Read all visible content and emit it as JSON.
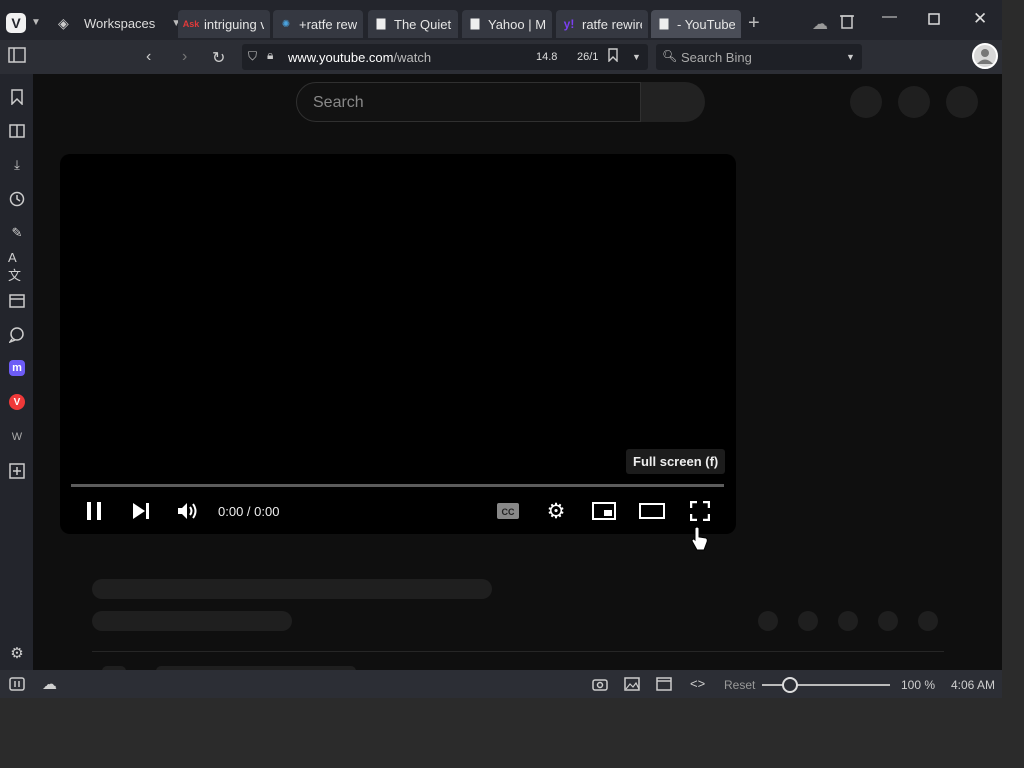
{
  "browser": {
    "workspaces_label": "Workspaces",
    "tabs": [
      {
        "title": "intriguing v",
        "fav": "ask-icon"
      },
      {
        "title": "+ratfe rewi",
        "fav": "wp-icon"
      },
      {
        "title": "The Quietu",
        "fav": "page-icon"
      },
      {
        "title": "Yahoo | Ma",
        "fav": "page-icon"
      },
      {
        "title": "ratfe rewire",
        "fav": "yahoo-icon"
      },
      {
        "title": "- YouTube",
        "fav": "page-icon"
      }
    ],
    "url_host": "www.youtube.com",
    "url_path": "/watch",
    "counter_a": "14.8",
    "counter_b": "26/1",
    "search_placeholder": "Search Bing"
  },
  "youtube": {
    "search_placeholder": "Search",
    "player": {
      "time": "0:00 / 0:00",
      "tooltip": "Full screen (f)"
    }
  },
  "statusbar": {
    "reset_label": "Reset",
    "zoom": "100 %",
    "clock": "4:06 AM",
    "zoom_fraction": 0.22
  }
}
